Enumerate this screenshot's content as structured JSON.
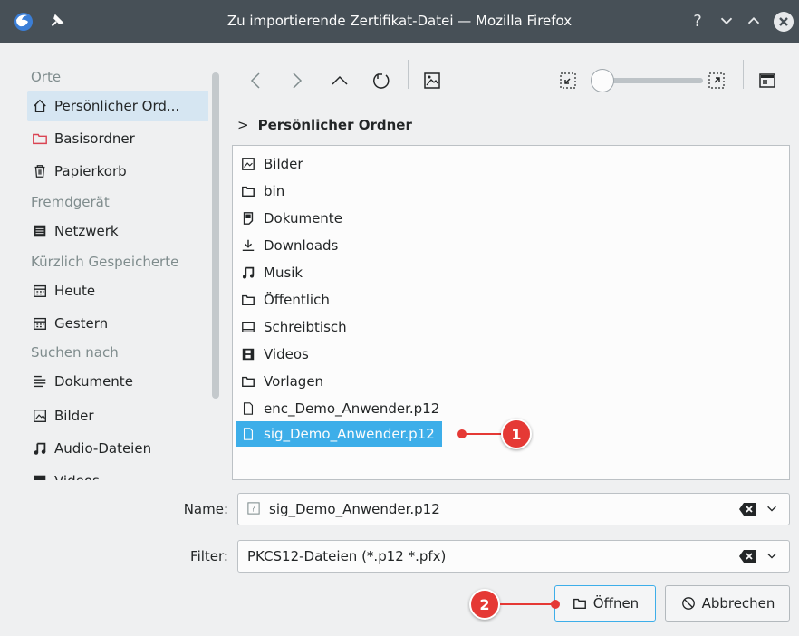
{
  "window": {
    "title": "Zu importierende Zertifikat-Datei — Mozilla Firefox"
  },
  "sidebar": {
    "sections": [
      {
        "heading": "Orte",
        "items": [
          "Persönlicher Ord...",
          "Basisordner",
          "Papierkorb"
        ]
      },
      {
        "heading": "Fremdgerät",
        "items": [
          "Netzwerk"
        ]
      },
      {
        "heading": "Kürzlich Gespeicherte",
        "items": [
          "Heute",
          "Gestern"
        ]
      },
      {
        "heading": "Suchen nach",
        "items": [
          "Dokumente",
          "Bilder",
          "Audio-Dateien",
          "Videos"
        ]
      }
    ]
  },
  "breadcrumb": {
    "current": "Persönlicher Ordner"
  },
  "files": [
    {
      "name": "Bilder",
      "icon": "image-folder-icon"
    },
    {
      "name": "bin",
      "icon": "folder-icon"
    },
    {
      "name": "Dokumente",
      "icon": "documents-folder-icon"
    },
    {
      "name": "Downloads",
      "icon": "download-folder-icon"
    },
    {
      "name": "Musik",
      "icon": "music-folder-icon"
    },
    {
      "name": "Öffentlich",
      "icon": "folder-icon"
    },
    {
      "name": "Schreibtisch",
      "icon": "desktop-folder-icon"
    },
    {
      "name": "Videos",
      "icon": "video-folder-icon"
    },
    {
      "name": "Vorlagen",
      "icon": "folder-icon"
    },
    {
      "name": "enc_Demo_Anwender.p12",
      "icon": "file-icon"
    },
    {
      "name": "sig_Demo_Anwender.p12",
      "icon": "file-icon",
      "selected": true
    }
  ],
  "form": {
    "name_label": "Name:",
    "name_value": "sig_Demo_Anwender.p12",
    "filter_label": "Filter:",
    "filter_value": "PKCS12-Dateien (*.p12 *.pfx)"
  },
  "buttons": {
    "open": "Öffnen",
    "cancel": "Abbrechen"
  },
  "callouts": [
    "1",
    "2"
  ],
  "colors": {
    "titlebar": "#475057",
    "selection": "#3daee9",
    "callout": "#e53935"
  }
}
